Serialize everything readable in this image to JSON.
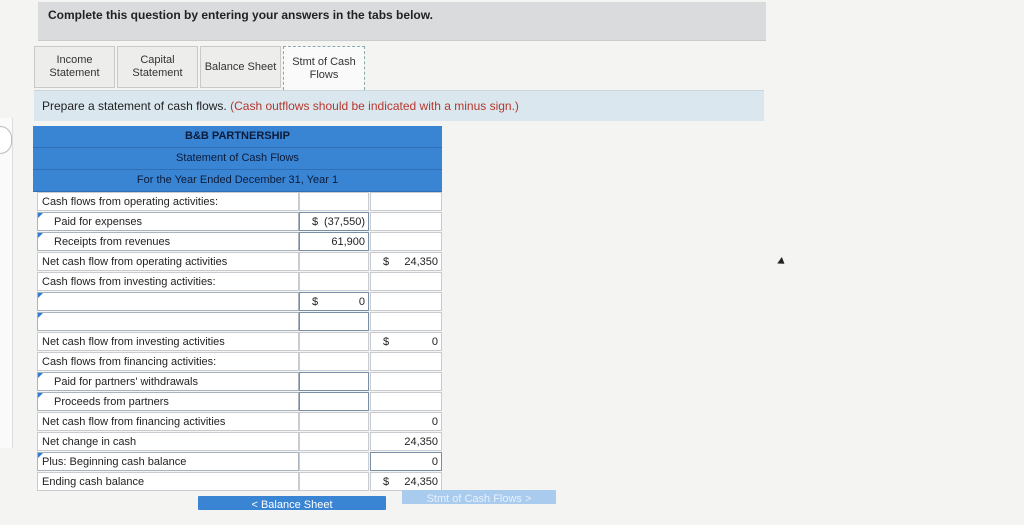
{
  "instruction": "Complete this question by entering your answers in the tabs below.",
  "tabs": [
    {
      "line1": "Income",
      "line2": "Statement"
    },
    {
      "line1": "Capital",
      "line2": "Statement"
    },
    {
      "line1": "Balance Sheet",
      "line2": ""
    },
    {
      "line1": "Stmt of Cash",
      "line2": "Flows"
    }
  ],
  "prompt": {
    "text": "Prepare a statement of cash flows.",
    "note": "(Cash outflows should be indicated with a minus sign.)"
  },
  "statement": {
    "company": "B&B PARTNERSHIP",
    "title": "Statement of Cash Flows",
    "period": "For the Year Ended December 31, Year 1",
    "rows": [
      {
        "label": "Cash flows from operating activities:",
        "c1": "",
        "c2": ""
      },
      {
        "label": "Paid for expenses",
        "c1_sign": "$",
        "c1": "(37,550)",
        "c2": ""
      },
      {
        "label": "Receipts from revenues",
        "c1": "61,900",
        "c2": ""
      },
      {
        "label": "Net cash flow from operating activities",
        "c1": "",
        "c2_sign": "$",
        "c2": "24,350"
      },
      {
        "label": "Cash flows from investing activities:",
        "c1": "",
        "c2": ""
      },
      {
        "label": "",
        "c1_sign": "$",
        "c1": "0",
        "c2": ""
      },
      {
        "label": "",
        "c1": "",
        "c2": ""
      },
      {
        "label": "Net cash flow from investing activities",
        "c1": "",
        "c2_sign": "$",
        "c2": "0"
      },
      {
        "label": "Cash flows from financing activities:",
        "c1": "",
        "c2": ""
      },
      {
        "label": "Paid for partners' withdrawals",
        "c1": "",
        "c2": ""
      },
      {
        "label": "Proceeds from partners",
        "c1": "",
        "c2": ""
      },
      {
        "label": "Net cash flow from financing activities",
        "c1": "",
        "c2": "0"
      },
      {
        "label": "Net change in cash",
        "c1": "",
        "c2": "24,350"
      },
      {
        "label": "Plus: Beginning cash balance",
        "c1": "",
        "c2": "0"
      },
      {
        "label": "Ending cash balance",
        "c1": "",
        "c2_sign": "$",
        "c2": "24,350"
      }
    ]
  },
  "nav": {
    "prev_label": "< Balance Sheet",
    "next_label": "Stmt of Cash Flows >"
  }
}
